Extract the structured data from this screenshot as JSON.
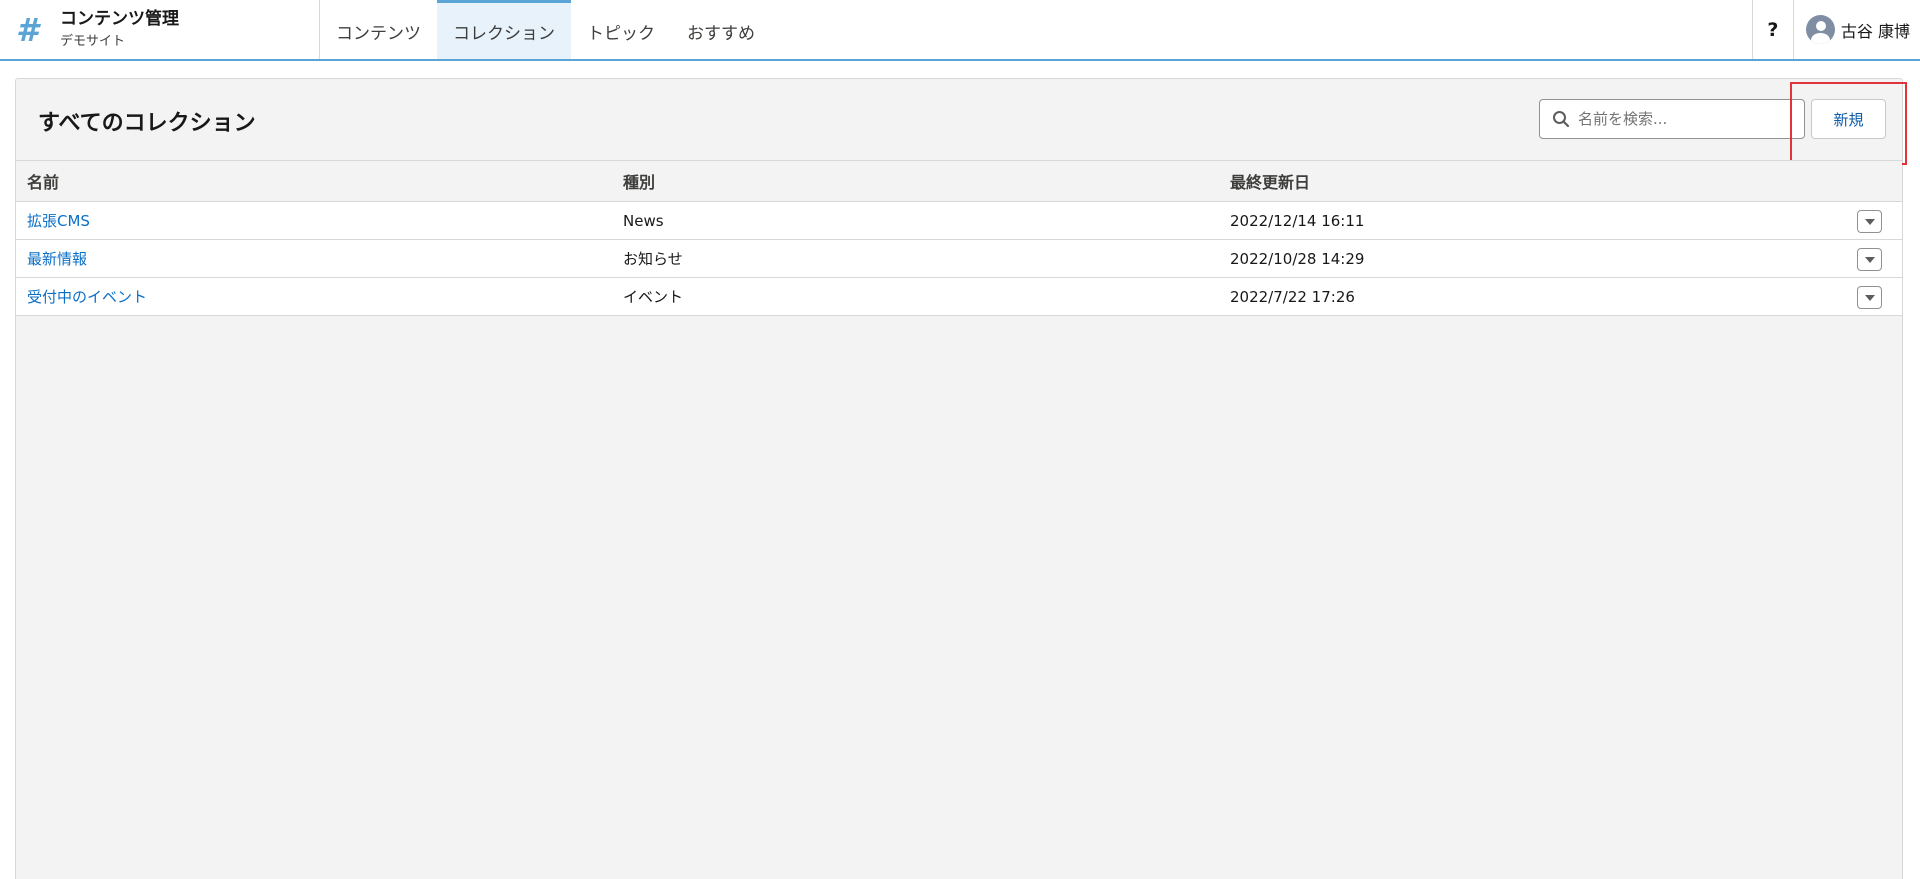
{
  "app": {
    "title": "コンテンツ管理",
    "site": "デモサイト",
    "brand_icon": "#"
  },
  "nav": {
    "tabs": [
      {
        "label": "コンテンツ",
        "active": false
      },
      {
        "label": "コレクション",
        "active": true
      },
      {
        "label": "トピック",
        "active": false
      },
      {
        "label": "おすすめ",
        "active": false
      }
    ]
  },
  "header": {
    "help_label": "?",
    "user_name": "古谷 康博"
  },
  "page": {
    "title": "すべてのコレクション",
    "search_placeholder": "名前を検索...",
    "new_button_label": "新規"
  },
  "table": {
    "columns": [
      "名前",
      "種別",
      "最終更新日"
    ],
    "rows": [
      {
        "name": "拡張CMS",
        "type": "News",
        "updated": "2022/12/14 16:11"
      },
      {
        "name": "最新情報",
        "type": "お知らせ",
        "updated": "2022/10/28 14:29"
      },
      {
        "name": "受付中のイベント",
        "type": "イベント",
        "updated": "2022/7/22 17:26"
      }
    ]
  },
  "colors": {
    "accent": "#5ba4d6",
    "link": "#0b6fc7",
    "highlight": "#e0343a",
    "panel_bg": "#f3f3f3"
  }
}
